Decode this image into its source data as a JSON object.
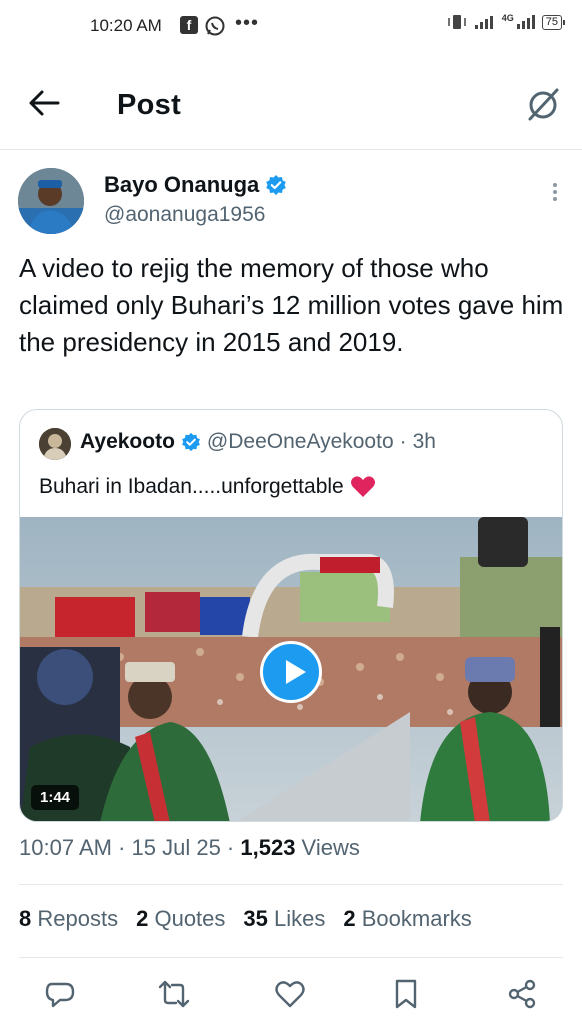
{
  "status_bar": {
    "time": "10:20 AM",
    "network": "4G",
    "battery": "75"
  },
  "header": {
    "title": "Post"
  },
  "author": {
    "name": "Bayo Onanuga",
    "handle": "@aonanuga1956"
  },
  "tweet": {
    "text": "A video to rejig the memory of those who claimed only Buhari’s 12 million votes gave him the presidency in 2015 and 2019."
  },
  "quote": {
    "name": "Ayekooto",
    "handle": "@DeeOneAyekooto",
    "separator": "·",
    "age": "3h",
    "text": "Buhari in Ibadan.....unforgettable",
    "emoji": "❤️",
    "video_duration": "1:44"
  },
  "meta": {
    "time": "10:07 AM",
    "sep1": " · ",
    "date": "15 Jul 25",
    "sep2": " · ",
    "views_count": "1,523",
    "views_label": " Views"
  },
  "stats": {
    "reposts_count": "8",
    "reposts_label": "Reposts",
    "quotes_count": "2",
    "quotes_label": "Quotes",
    "likes_count": "35",
    "likes_label": "Likes",
    "bookmarks_count": "2",
    "bookmarks_label": "Bookmarks"
  },
  "icons": {
    "back": "arrow-left-icon",
    "grok": "grok-icon",
    "more": "more-vertical-icon",
    "reply": "reply-icon",
    "retweet": "retweet-icon",
    "like": "heart-icon",
    "bookmark": "bookmark-icon",
    "share": "share-icon"
  },
  "colors": {
    "accent": "#1d9bf0",
    "text_primary": "#0f1419",
    "text_secondary": "#536471",
    "border": "#cfd9de"
  }
}
